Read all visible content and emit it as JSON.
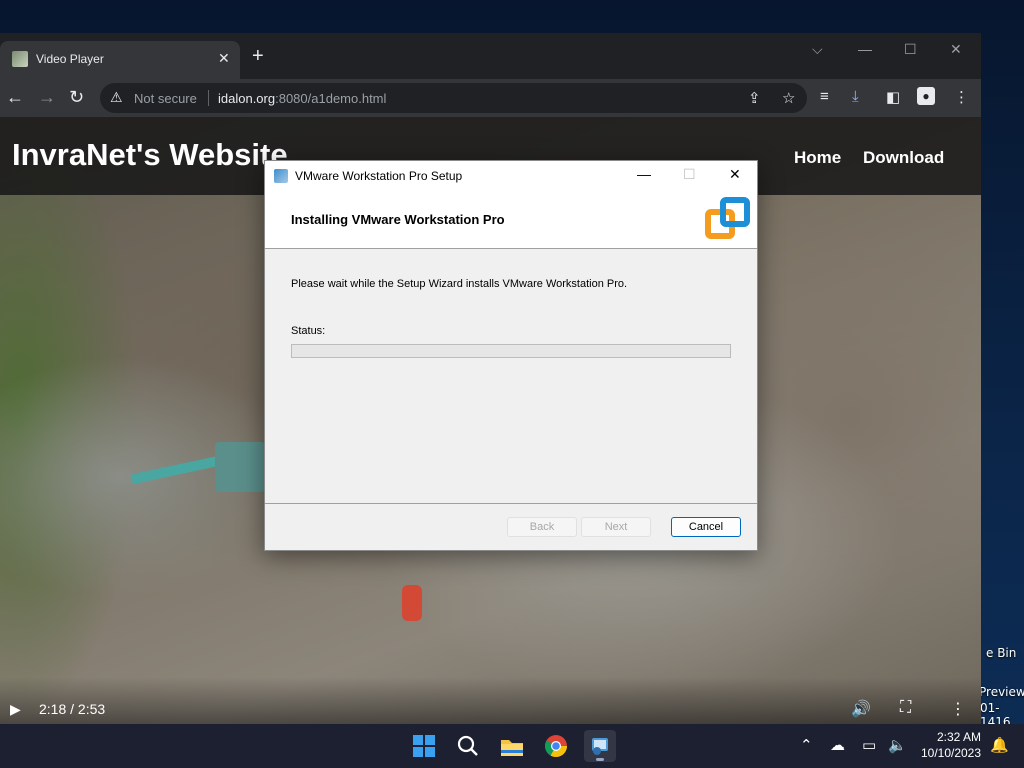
{
  "desktop": {
    "labels": [
      "e Bin",
      "Preview",
      "01-1416"
    ]
  },
  "browser": {
    "tab_title": "Video Player",
    "tab_close": "✕",
    "new_tab": "+",
    "not_secure": "Not secure",
    "url_host": "idalon.org",
    "url_rest": ":8080/a1demo.html",
    "window_controls": [
      "⌵",
      "—",
      "☐",
      "✕"
    ]
  },
  "page": {
    "site_title": "InvraNet's Website",
    "nav": [
      "Home",
      "Download"
    ],
    "video": {
      "time": "2:18 / 2:53",
      "progress": 0.798
    }
  },
  "dialog": {
    "title": "VMware Workstation Pro Setup",
    "heading": "Installing VMware Workstation Pro",
    "description": "Please wait while the Setup Wizard installs VMware Workstation Pro.",
    "status_label": "Status:",
    "progress": 0,
    "buttons": {
      "back": "Back",
      "next": "Next",
      "cancel": "Cancel"
    },
    "controls": {
      "minimize": "—",
      "maximize": "☐",
      "close": "✕"
    }
  },
  "taskbar": {
    "time": "2:32 AM",
    "date": "10/10/2023"
  },
  "colors": {
    "vmware_orange": "#f39c1e",
    "vmware_blue": "#1d8fd6",
    "progress_accent": "#06b025"
  }
}
